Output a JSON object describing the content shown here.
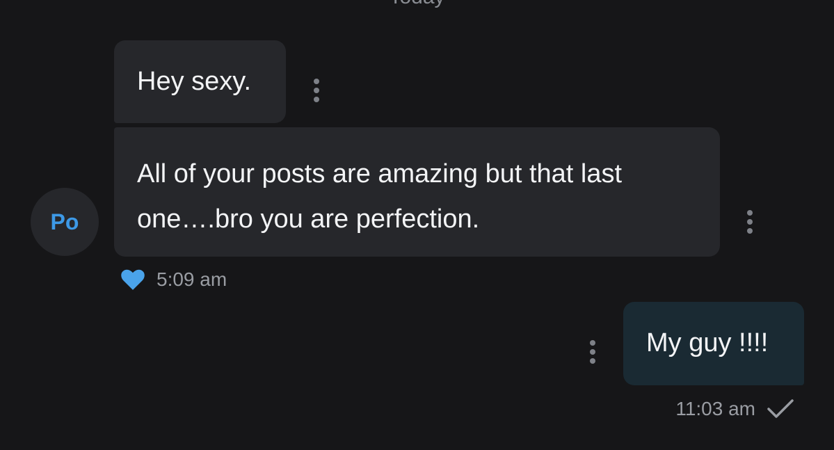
{
  "date_separator": "Today",
  "contact": {
    "avatar_initials": "Po"
  },
  "messages": [
    {
      "direction": "incoming",
      "text": "Hey sexy."
    },
    {
      "direction": "incoming",
      "text": "All of your posts are amazing but that last one….bro you are perfection."
    },
    {
      "direction": "outgoing",
      "text": "My guy !!!!"
    }
  ],
  "incoming_group": {
    "time": "5:09 am",
    "reaction_icon": "heart-icon",
    "reaction_color": "#4aa3ea"
  },
  "outgoing_group": {
    "time": "11:03 am",
    "status_icon": "checkmark-icon"
  },
  "colors": {
    "background": "#161618",
    "incoming_bubble": "#26272b",
    "outgoing_bubble": "#1a2a33",
    "avatar_text": "#3d99e6"
  }
}
